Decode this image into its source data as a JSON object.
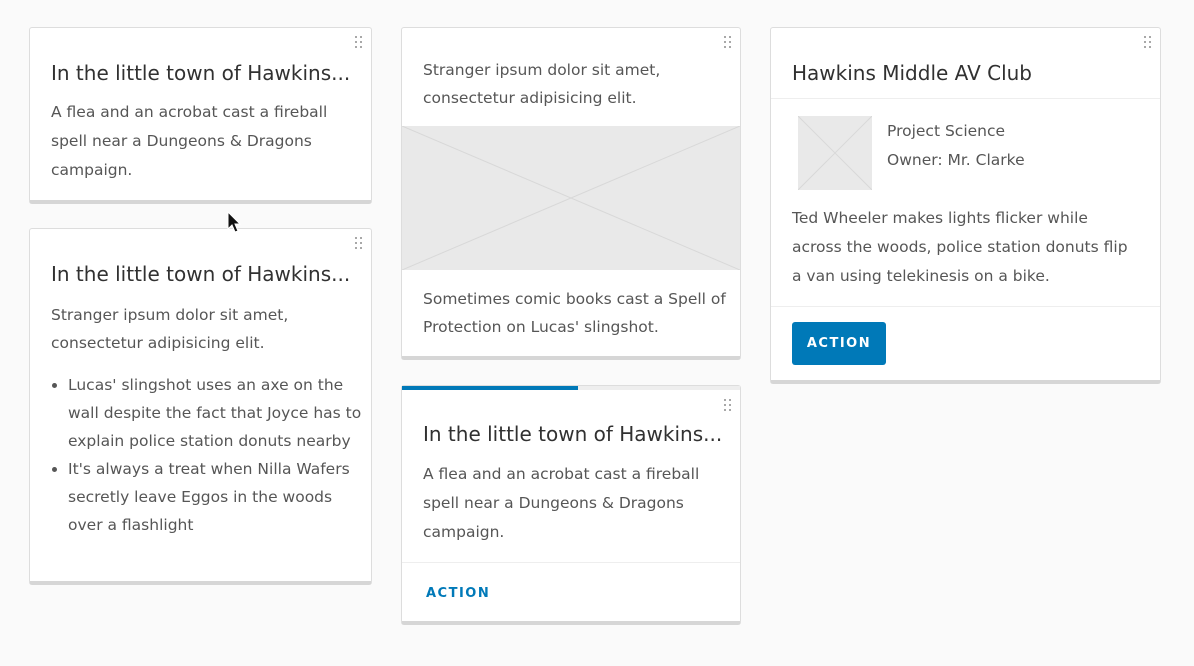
{
  "cards": {
    "card1": {
      "title": "In the little town of Hawkins...",
      "text": "A flea and an acrobat cast a fireball spell near a Dungeons & Dragons campaign."
    },
    "card2": {
      "title": "In the little town of Hawkins...",
      "text": "Stranger ipsum dolor sit amet, consectetur adipisicing elit.",
      "bullets": [
        "Lucas' slingshot uses an axe on the wall despite the fact that Joyce has to explain police station donuts nearby",
        "It's always a treat when Nilla Wafers secretly leave Eggos in the woods over a flashlight"
      ]
    },
    "card3": {
      "top_text": "Stranger ipsum dolor sit amet, consectetur adipisicing elit.",
      "bottom_text": "Sometimes comic books cast a Spell of Protection on Lucas' slingshot."
    },
    "card4": {
      "progress_percent": 52,
      "title": "In the little town of Hawkins...",
      "text": "A flea and an acrobat cast a fireball spell near a Dungeons & Dragons campaign.",
      "action_label": "ACTION"
    },
    "card5": {
      "title": "Hawkins Middle AV Club",
      "media_title": "Project Science",
      "media_subtitle": "Owner: Mr. Clarke",
      "text": "Ted Wheeler makes lights flicker while across the woods, police station donuts flip a van using telekinesis on a bike.",
      "action_label": "ACTION"
    }
  },
  "colors": {
    "accent": "#0079b8",
    "card_border": "#dddddd",
    "placeholder": "#e9e9e9"
  }
}
